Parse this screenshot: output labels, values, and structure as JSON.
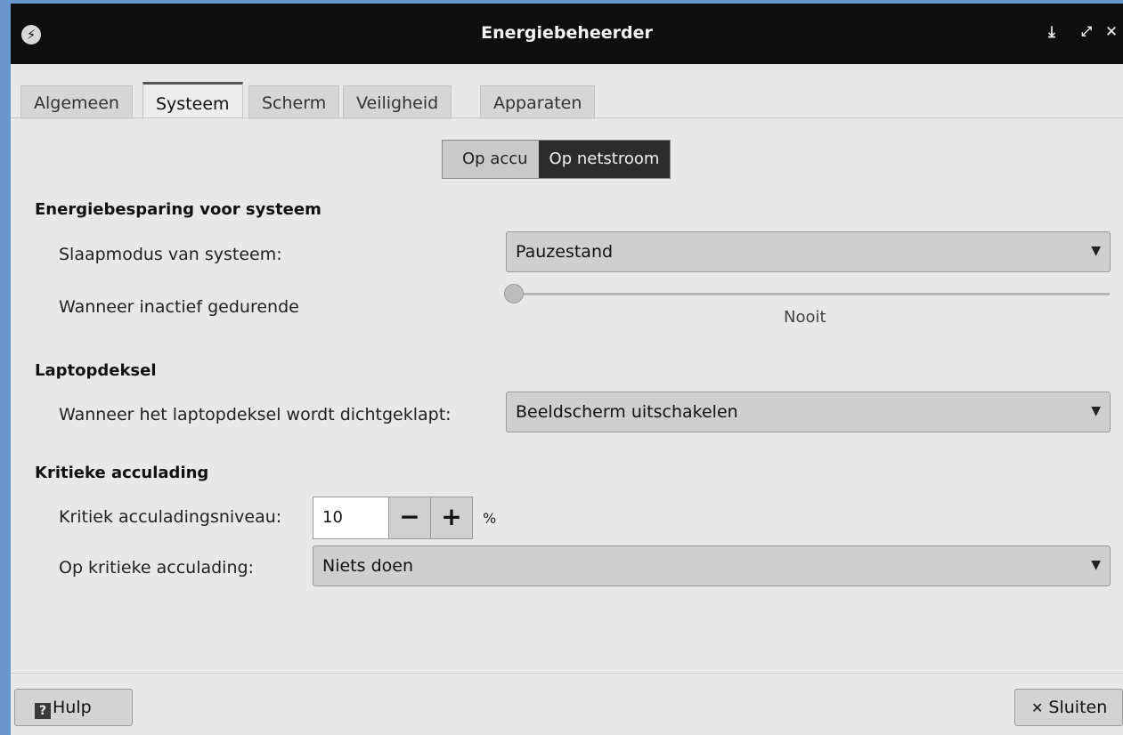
{
  "window": {
    "title": "Energiebeheerder",
    "icons": {
      "app": "power-icon",
      "minimize": "minimize-icon",
      "maximize": "maximize-icon",
      "close": "close-icon"
    }
  },
  "tabs": [
    {
      "label": "Algemeen",
      "active": false
    },
    {
      "label": "Systeem",
      "active": true
    },
    {
      "label": "Scherm",
      "active": false
    },
    {
      "label": "Veiligheid",
      "active": false
    },
    {
      "label": "Apparaten",
      "active": false
    }
  ],
  "power_source_toggle": {
    "options": [
      "Op accu",
      "Op netstroom"
    ],
    "selected": "Op netstroom"
  },
  "sections": {
    "system": {
      "heading": "Energiebesparing voor systeem",
      "sleep_mode_label": "Slaapmodus van systeem:",
      "sleep_mode_value": "Pauzestand",
      "inactive_label": "Wanneer inactief gedurende",
      "inactive_value": "Nooit",
      "inactive_slider_fraction": 0
    },
    "lid": {
      "heading": "Laptopdeksel",
      "lid_label": "Wanneer het laptopdeksel wordt dichtgeklapt:",
      "lid_value": "Beeldscherm uitschakelen"
    },
    "battery": {
      "heading": "Kritieke acculading",
      "level_label": "Kritiek acculadingsniveau:",
      "level_value": "10",
      "level_unit": "%",
      "action_label": "Op kritieke acculading:",
      "action_value": "Niets doen"
    }
  },
  "footer": {
    "help_label": "Hulp",
    "close_label": "Sluiten"
  }
}
